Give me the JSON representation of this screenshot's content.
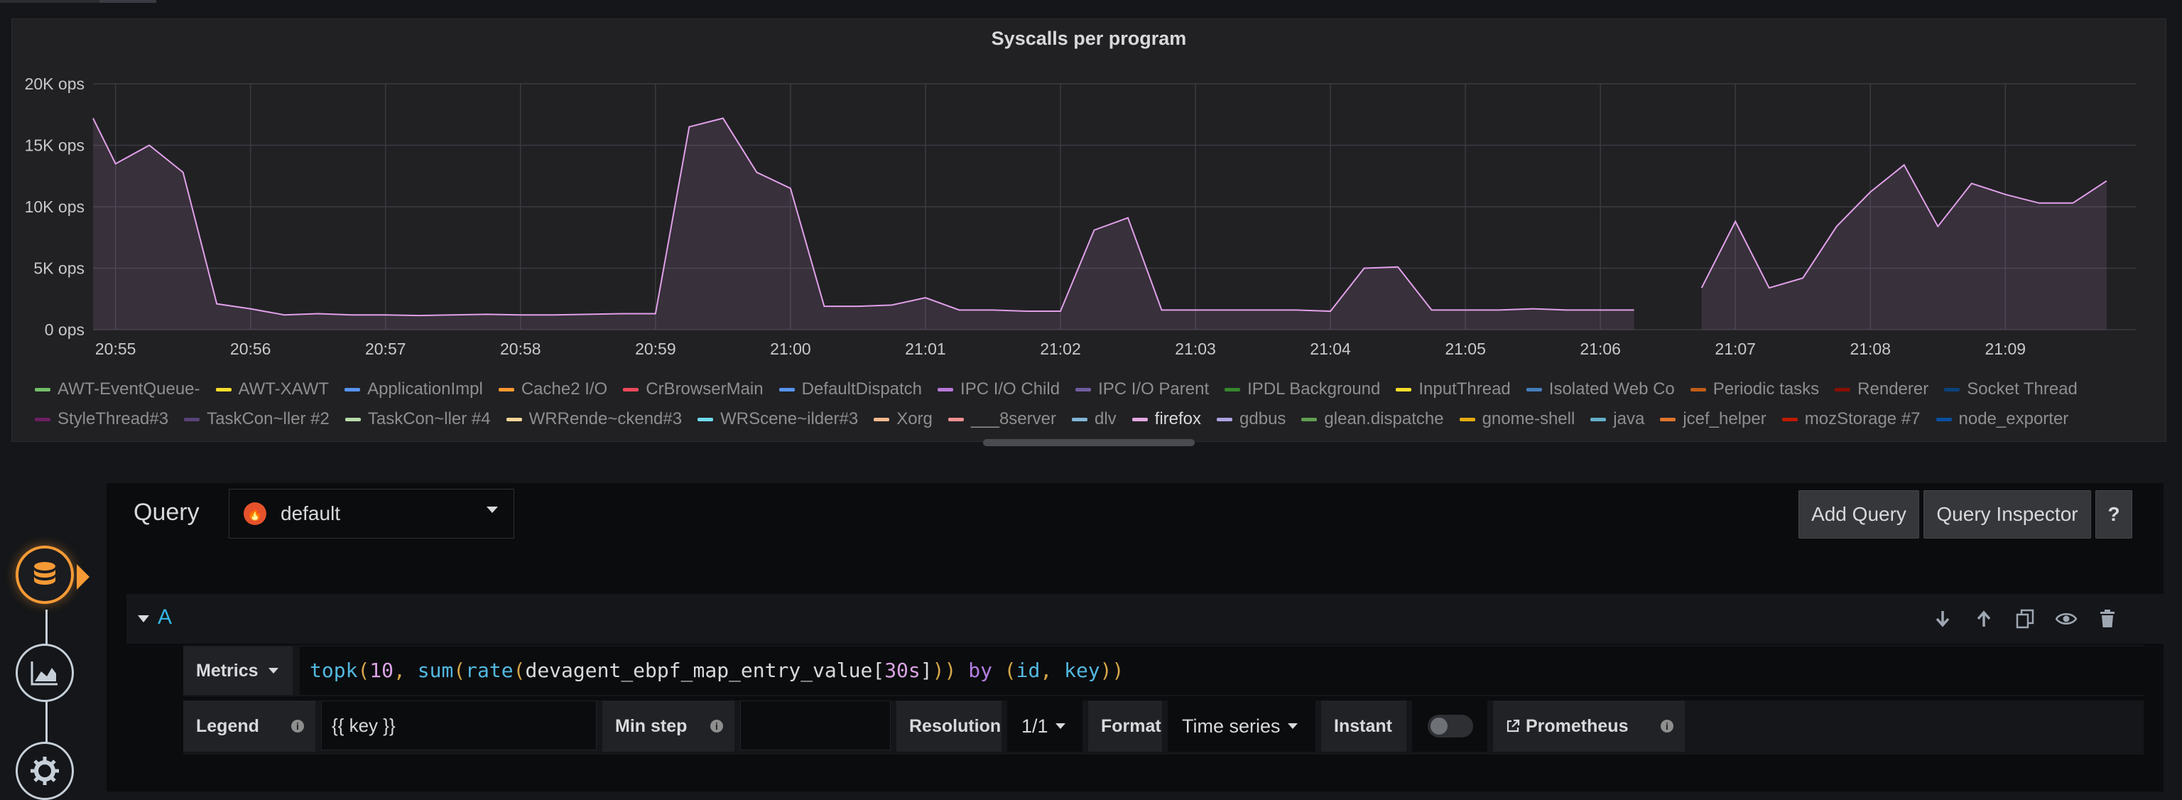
{
  "panel": {
    "title": "Syscalls per program"
  },
  "chart_data": {
    "type": "area",
    "title": "Syscalls per program",
    "xlabel": "",
    "ylabel": "",
    "y_ticks": [
      "0 ops",
      "5K ops",
      "10K ops",
      "15K ops",
      "20K ops"
    ],
    "y_tick_values": [
      0,
      5000,
      10000,
      15000,
      20000
    ],
    "ylim": [
      0,
      20000
    ],
    "x_ticks": [
      "20:55",
      "20:56",
      "20:57",
      "20:58",
      "20:59",
      "21:00",
      "21:01",
      "21:02",
      "21:03",
      "21:04",
      "21:05",
      "21:06",
      "21:07",
      "21:08",
      "21:09"
    ],
    "x_range": [
      "20:54:50",
      "21:09:58"
    ],
    "grid": true,
    "series_color": "#e0a0e8",
    "series": [
      {
        "name": "firefox",
        "points": [
          [
            "20:54:50",
            17200
          ],
          [
            "20:55:00",
            13500
          ],
          [
            "20:55:15",
            15000
          ],
          [
            "20:55:30",
            12800
          ],
          [
            "20:55:45",
            2100
          ],
          [
            "20:56:00",
            1700
          ],
          [
            "20:56:15",
            1200
          ],
          [
            "20:56:30",
            1300
          ],
          [
            "20:56:45",
            1200
          ],
          [
            "20:57:00",
            1200
          ],
          [
            "20:57:15",
            1150
          ],
          [
            "20:57:30",
            1200
          ],
          [
            "20:57:45",
            1250
          ],
          [
            "20:58:00",
            1200
          ],
          [
            "20:58:15",
            1200
          ],
          [
            "20:58:30",
            1250
          ],
          [
            "20:58:45",
            1300
          ],
          [
            "20:59:00",
            1300
          ],
          [
            "20:59:15",
            16500
          ],
          [
            "20:59:30",
            17200
          ],
          [
            "20:59:45",
            12800
          ],
          [
            "21:00:00",
            11500
          ],
          [
            "21:00:15",
            1900
          ],
          [
            "21:00:30",
            1900
          ],
          [
            "21:00:45",
            2000
          ],
          [
            "21:01:00",
            2600
          ],
          [
            "21:01:15",
            1600
          ],
          [
            "21:01:30",
            1600
          ],
          [
            "21:01:45",
            1500
          ],
          [
            "21:02:00",
            1500
          ],
          [
            "21:02:15",
            8100
          ],
          [
            "21:02:30",
            9100
          ],
          [
            "21:02:45",
            1600
          ],
          [
            "21:03:00",
            1600
          ],
          [
            "21:03:15",
            1600
          ],
          [
            "21:03:30",
            1600
          ],
          [
            "21:03:45",
            1600
          ],
          [
            "21:04:00",
            1500
          ],
          [
            "21:04:15",
            5000
          ],
          [
            "21:04:30",
            5100
          ],
          [
            "21:04:45",
            1600
          ],
          [
            "21:05:00",
            1600
          ],
          [
            "21:05:15",
            1600
          ],
          [
            "21:05:30",
            1700
          ],
          [
            "21:05:45",
            1600
          ],
          [
            "21:06:00",
            1600
          ],
          [
            "21:06:15",
            1600
          ],
          null,
          [
            "21:06:45",
            3400
          ],
          [
            "21:07:00",
            8800
          ],
          [
            "21:07:15",
            3400
          ],
          [
            "21:07:30",
            4200
          ],
          [
            "21:07:45",
            8400
          ],
          [
            "21:08:00",
            11200
          ],
          [
            "21:08:15",
            13400
          ],
          [
            "21:08:30",
            8400
          ],
          [
            "21:08:45",
            11900
          ],
          [
            "21:09:00",
            11000
          ],
          [
            "21:09:15",
            10300
          ],
          [
            "21:09:30",
            10300
          ],
          [
            "21:09:45",
            12100
          ]
        ]
      }
    ]
  },
  "legend": {
    "rows": [
      [
        {
          "label": "AWT-EventQueue-",
          "color": "#73bf69"
        },
        {
          "label": "AWT-XAWT",
          "color": "#fade2a"
        },
        {
          "label": "ApplicationImpl",
          "color": "#5794f2"
        },
        {
          "label": "Cache2 I/O",
          "color": "#ff9830"
        },
        {
          "label": "CrBrowserMain",
          "color": "#f2495c"
        },
        {
          "label": "DefaultDispatch",
          "color": "#5794f2"
        },
        {
          "label": "IPC I/O Child",
          "color": "#b877d9"
        },
        {
          "label": "IPC I/O Parent",
          "color": "#705da0"
        },
        {
          "label": "IPDL Background",
          "color": "#37872d"
        },
        {
          "label": "InputThread",
          "color": "#fade2a"
        },
        {
          "label": "Isolated Web Co",
          "color": "#447ebc"
        },
        {
          "label": "Periodic tasks",
          "color": "#c15c17"
        },
        {
          "label": "Renderer",
          "color": "#890f02"
        },
        {
          "label": "Socket Thread",
          "color": "#0a437c"
        }
      ],
      [
        {
          "label": "StyleThread#3",
          "color": "#6d1f62"
        },
        {
          "label": "TaskCon~ller #2",
          "color": "#584477"
        },
        {
          "label": "TaskCon~ller #4",
          "color": "#b7dbab"
        },
        {
          "label": "WRRende~ckend#3",
          "color": "#f4d598"
        },
        {
          "label": "WRScene~ilder#3",
          "color": "#70dbed"
        },
        {
          "label": "Xorg",
          "color": "#f9ba8f"
        },
        {
          "label": "___8server",
          "color": "#f29191"
        },
        {
          "label": "dlv",
          "color": "#82b5d8"
        },
        {
          "label": "firefox",
          "color": "#e5a8e2",
          "active": true
        },
        {
          "label": "gdbus",
          "color": "#aea2e0"
        },
        {
          "label": "glean.dispatche",
          "color": "#629e51"
        },
        {
          "label": "gnome-shell",
          "color": "#e5ac0e"
        },
        {
          "label": "java",
          "color": "#64b0c8"
        },
        {
          "label": "jcef_helper",
          "color": "#e0752d"
        },
        {
          "label": "mozStorage #7",
          "color": "#bf1b00"
        },
        {
          "label": "node_exporter",
          "color": "#0a50a1"
        }
      ]
    ]
  },
  "editor": {
    "query_label": "Query",
    "datasource": "default",
    "add_query": "Add Query",
    "query_inspector": "Query Inspector",
    "help": "?",
    "query_letter": "A",
    "metrics_label": "Metrics",
    "expr": "topk(10, sum(rate(devagent_ebpf_map_entry_value[30s])) by (id, key))",
    "legend_label": "Legend",
    "legend_value": "{{ key }}",
    "min_step_label": "Min step",
    "min_step_value": "",
    "resolution_label": "Resolution",
    "resolution_value": "1/1",
    "format_label": "Format",
    "format_value": "Time series",
    "instant_label": "Instant",
    "instant_on": false,
    "prometheus_label": "Prometheus",
    "info_glyph": "i"
  },
  "nav": {
    "items": [
      "database-icon",
      "chart-icon",
      "gear-icon"
    ],
    "active": "database-icon",
    "accent": "#f69a35"
  }
}
